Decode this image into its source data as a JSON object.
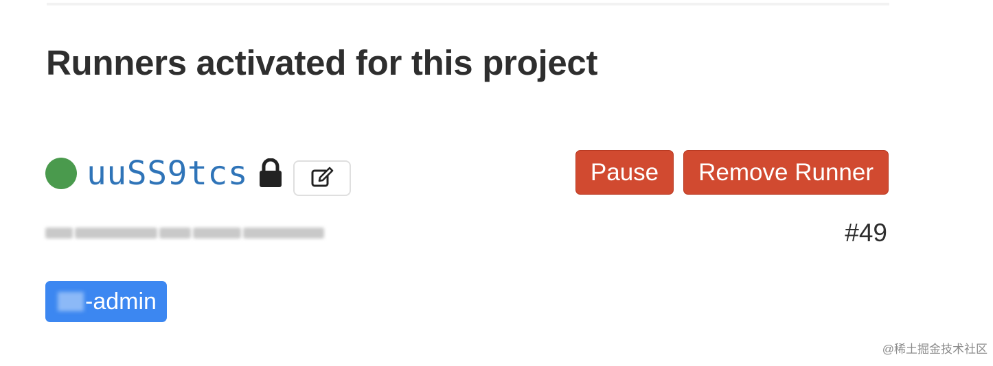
{
  "section": {
    "title": "Runners activated for this project"
  },
  "runner": {
    "token": "uuSS9tcs",
    "status_color": "#4a9a4d",
    "description": "",
    "id_label": "#49",
    "tag": "-admin"
  },
  "actions": {
    "pause_label": "Pause",
    "remove_label": "Remove Runner"
  },
  "icons": {
    "status": "status-online-dot",
    "lock": "lock-icon",
    "edit": "edit-pencil-icon"
  },
  "colors": {
    "danger": "#d14a30",
    "link": "#2f74b8",
    "tag": "#3c87f1"
  },
  "watermark": "@稀土掘金技术社区"
}
